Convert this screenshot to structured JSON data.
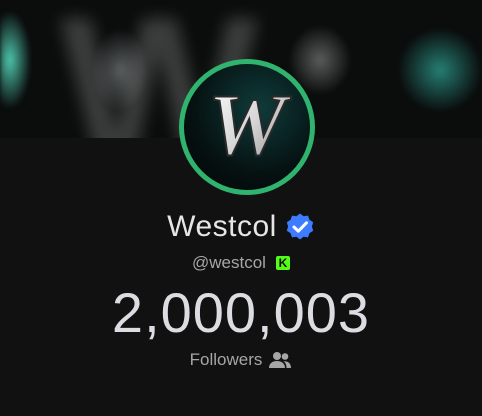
{
  "profile": {
    "display_name": "Westcol",
    "handle": "@westcol",
    "followers_count": "2,000,003",
    "followers_label": "Followers",
    "avatar_letter": "W"
  },
  "platform_badge": {
    "letter": "K",
    "color": "#53fc18"
  },
  "icons": {
    "verified": "verified-check-icon",
    "followers": "users-icon"
  },
  "colors": {
    "background": "#111111",
    "avatar_ring": "#2fb36e",
    "verified_blue": "#3d7bff"
  }
}
